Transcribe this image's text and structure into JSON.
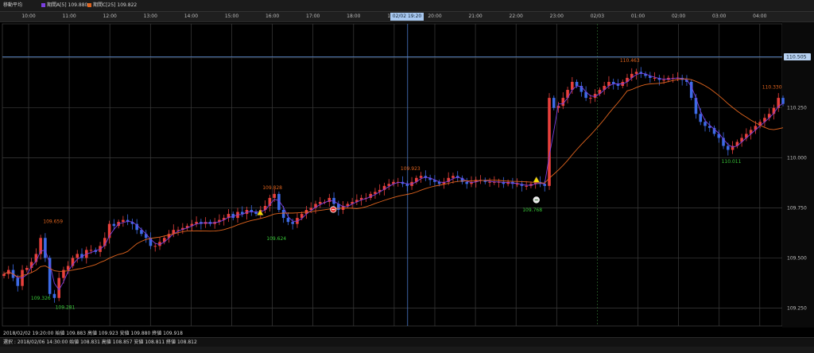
{
  "legend": {
    "title": "移動平均",
    "series_a": "期間A[5] 109.880",
    "series_b": "期間C[25] 109.822"
  },
  "status": {
    "line1": "2018/02/02 19:20:00 始値 109.883 高値 109.923 安値 109.880 終値 109.918",
    "line2": "選択 : 2018/02/06 14:30:00 始値 108.831 高値 108.857 安値 108.811 終値 108.812"
  },
  "colors": {
    "up": "#e8403c",
    "down": "#3d6be6",
    "ma_short": "#7a3fe0",
    "ma_long": "#e0641e"
  },
  "chart_data": {
    "type": "candlestick",
    "title": "",
    "x_tick_labels": [
      "10:00",
      "11:00",
      "12:00",
      "13:00",
      "14:00",
      "15:00",
      "16:00",
      "17:00",
      "18:00",
      "19:00",
      "20:00",
      "21:00",
      "22:00",
      "23:00",
      "02/03",
      "01:00",
      "02:00",
      "03:00",
      "04:00"
    ],
    "cursor_time_label": "02/02 19:20",
    "y_tick_labels": [
      "110.500",
      "110.250",
      "110.000",
      "109.750",
      "109.500",
      "109.250"
    ],
    "ylim": [
      109.16,
      110.67
    ],
    "current_price_label": "110.505",
    "annotations": [
      {
        "text": "109.659",
        "kind": "high",
        "x": 0.6,
        "y": 109.659
      },
      {
        "text": "109.326",
        "kind": "low",
        "x": 0.3,
        "y": 109.326
      },
      {
        "text": "109.281",
        "kind": "low",
        "x": 0.9,
        "y": 109.281
      },
      {
        "text": "109.828",
        "kind": "high",
        "x": 6.0,
        "y": 109.828
      },
      {
        "text": "109.624",
        "kind": "low",
        "x": 6.1,
        "y": 109.624
      },
      {
        "text": "109.923",
        "kind": "high",
        "x": 9.4,
        "y": 109.923
      },
      {
        "text": "109.768",
        "kind": "low",
        "x": 12.4,
        "y": 109.768
      },
      {
        "text": "110.463",
        "kind": "high",
        "x": 14.8,
        "y": 110.463
      },
      {
        "text": "110.011",
        "kind": "low",
        "x": 17.3,
        "y": 110.011
      },
      {
        "text": "110.330",
        "kind": "high",
        "x": 18.3,
        "y": 110.33
      }
    ],
    "markers": [
      {
        "shape": "triangle",
        "x": 5.7,
        "y": 109.726
      },
      {
        "shape": "circle-up",
        "x": 7.5,
        "y": 109.742
      },
      {
        "shape": "triangle",
        "x": 12.5,
        "y": 109.89
      },
      {
        "shape": "circle-down",
        "x": 12.5,
        "y": 109.79
      }
    ],
    "closes": [
      109.42,
      109.44,
      109.4,
      109.36,
      109.44,
      109.45,
      109.48,
      109.52,
      109.6,
      109.5,
      109.32,
      109.3,
      109.4,
      109.44,
      109.46,
      109.5,
      109.52,
      109.5,
      109.54,
      109.54,
      109.53,
      109.56,
      109.6,
      109.67,
      109.66,
      109.68,
      109.69,
      109.68,
      109.67,
      109.64,
      109.62,
      109.6,
      109.56,
      109.56,
      109.58,
      109.6,
      109.62,
      109.64,
      109.64,
      109.65,
      109.66,
      109.67,
      109.68,
      109.67,
      109.68,
      109.67,
      109.68,
      109.69,
      109.7,
      109.72,
      109.7,
      109.73,
      109.72,
      109.74,
      109.73,
      109.72,
      109.74,
      109.76,
      109.8,
      109.82,
      109.74,
      109.7,
      109.68,
      109.67,
      109.7,
      109.72,
      109.74,
      109.75,
      109.77,
      109.78,
      109.78,
      109.8,
      109.77,
      109.74,
      109.76,
      109.77,
      109.78,
      109.79,
      109.8,
      109.8,
      109.82,
      109.83,
      109.84,
      109.86,
      109.87,
      109.88,
      109.88,
      109.87,
      109.86,
      109.88,
      109.9,
      109.91,
      109.9,
      109.89,
      109.88,
      109.87,
      109.88,
      109.9,
      109.91,
      109.9,
      109.88,
      109.87,
      109.88,
      109.89,
      109.89,
      109.88,
      109.88,
      109.88,
      109.88,
      109.87,
      109.88,
      109.87,
      109.87,
      109.86,
      109.86,
      109.87,
      109.88,
      109.87,
      109.86,
      110.3,
      110.25,
      110.26,
      110.3,
      110.34,
      110.38,
      110.36,
      110.33,
      110.3,
      110.3,
      110.32,
      110.34,
      110.36,
      110.38,
      110.37,
      110.36,
      110.38,
      110.4,
      110.42,
      110.43,
      110.42,
      110.41,
      110.4,
      110.4,
      110.39,
      110.39,
      110.4,
      110.4,
      110.4,
      110.39,
      110.38,
      110.3,
      110.22,
      110.18,
      110.16,
      110.15,
      110.12,
      110.1,
      110.06,
      110.04,
      110.06,
      110.08,
      110.1,
      110.12,
      110.14,
      110.16,
      110.18,
      110.2,
      110.22,
      110.25,
      110.3,
      110.27
    ]
  }
}
